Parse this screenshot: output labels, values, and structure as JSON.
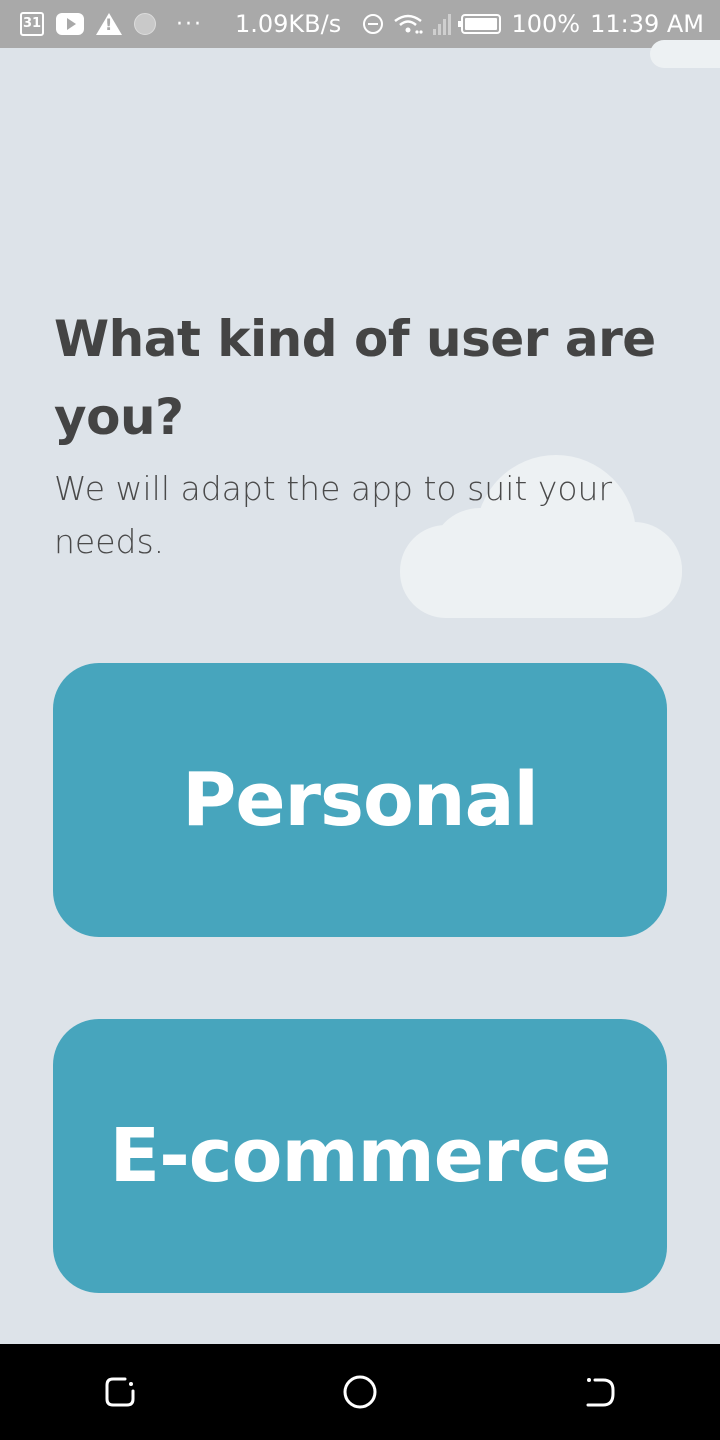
{
  "status_bar": {
    "calendar_day": "31",
    "more_indicator": "···",
    "net_speed": "1.09KB/s",
    "battery": "100%",
    "time": "11:39 AM",
    "icons": [
      "calendar-icon",
      "youtube-icon",
      "warning-icon",
      "notification-dot-icon",
      "more-icon",
      "do-not-disturb-icon",
      "wifi-icon",
      "signal-icon",
      "battery-icon"
    ]
  },
  "main": {
    "heading": "What kind of user are you?",
    "subtitle": "We will adapt the app to suit your needs.",
    "options": [
      {
        "label": "Personal"
      },
      {
        "label": "E-commerce"
      }
    ]
  },
  "nav_bar": {
    "icons": [
      "recents-icon",
      "home-icon",
      "back-icon"
    ]
  },
  "colors": {
    "background": "#dde3e9",
    "button": "#47a5bd",
    "button_text": "#ffffff",
    "heading_text": "#444444",
    "status_bar": "#a9a9a9",
    "cloud": "#edf1f3",
    "nav_bar": "#000000"
  }
}
